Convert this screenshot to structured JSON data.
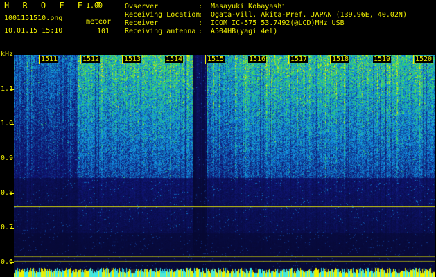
{
  "header": {
    "app_title": "H R O F F T",
    "version": "1.00",
    "filename": "1001151510.png",
    "datetime": "10.01.15 15:10",
    "meteor_label": "meteor",
    "meteor_count": "101"
  },
  "info": [
    {
      "label": "Ovserver",
      "value": "Masayuki Kobayashi"
    },
    {
      "label": "Receiving Location",
      "value": "Ogata-vill. Akita-Pref. JAPAN (139.96E, 40.02N)"
    },
    {
      "label": "Receiver",
      "value": "ICOM IC-575 53.7492(@LCD)MHz USB"
    },
    {
      "label": "Receiving antenna",
      "value": "A504HB(yagi 4el)"
    }
  ],
  "info_colon": ":",
  "axis": {
    "y_unit": "kHz",
    "y_ticks": [
      "1.1",
      "1.0",
      "0.9",
      "0.8",
      "0.7",
      "0.6"
    ],
    "x_ticks": [
      "1511",
      "1512",
      "1513",
      "1514",
      "1515",
      "1516",
      "1517",
      "1518",
      "1519",
      "1520"
    ]
  },
  "colors": {
    "text": "#f0f000",
    "background": "#000000",
    "spectrum_low": "#0a0a4a",
    "spectrum_mid": "#1e64d0",
    "spectrum_high": "#2adc5a",
    "spectrum_peak": "#f0f000"
  }
}
